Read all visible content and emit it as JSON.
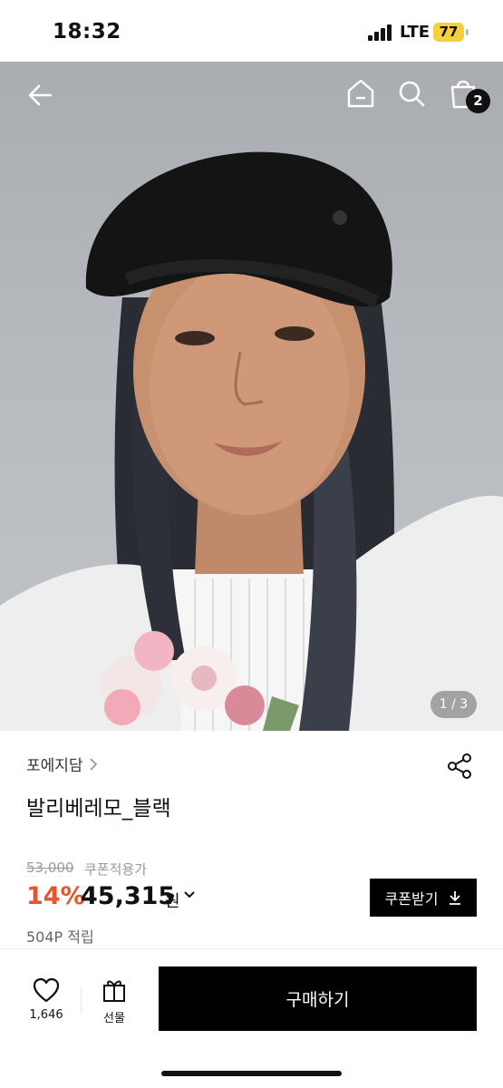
{
  "status_bar": {
    "time": "18:32",
    "network": "LTE",
    "battery": "77"
  },
  "nav": {
    "cart_count": "2"
  },
  "gallery": {
    "counter": "1 / 3"
  },
  "product": {
    "brand": "포에지담",
    "title": "발리베레모_블랙",
    "original_price": "53,000",
    "coupon_label": "쿠폰적용가",
    "discount": "14%",
    "price": "45,315",
    "currency": "원",
    "coupon_button": "쿠폰받기",
    "points": "504P 적립"
  },
  "bottom_bar": {
    "like_count": "1,646",
    "gift_label": "선물",
    "buy_label": "구매하기"
  },
  "colors": {
    "discount": "#e8542b",
    "buy_button": "#000000",
    "battery": "#f4d03f"
  },
  "icons": [
    "back-arrow-icon",
    "home-icon",
    "search-icon",
    "shopping-bag-icon",
    "chevron-right-icon",
    "share-icon",
    "chevron-down-icon",
    "download-icon",
    "heart-icon",
    "gift-icon"
  ]
}
